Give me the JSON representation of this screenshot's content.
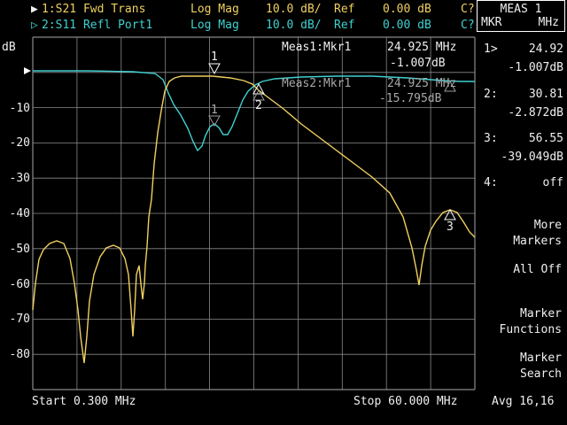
{
  "header": {
    "trace1": {
      "label": "1:S21 Fwd Trans",
      "format": "Log Mag",
      "scale": "10.0 dB/",
      "ref_label": "Ref",
      "ref_value": "0.00 dB",
      "flag": "C?"
    },
    "trace2": {
      "label": "2:S11 Refl Port1",
      "format": "Log Mag",
      "scale": "10.0 dB/",
      "ref_label": "Ref",
      "ref_value": "0.00 dB",
      "flag": "C?"
    }
  },
  "meas_box": {
    "title": "MEAS 1",
    "left": "MKR",
    "right": "MHz"
  },
  "unit_label": "dB",
  "y_ticks": [
    "-10",
    "-20",
    "-30",
    "-40",
    "-50",
    "-60",
    "-70",
    "-80"
  ],
  "meas1": {
    "label": "Meas1:Mkr1",
    "freq": "24.925 MHz",
    "value": "-1.007dB"
  },
  "meas2": {
    "label": "Meas2:Mkr1",
    "freq": "24.925 MHz",
    "value": "-15.795dB"
  },
  "marker_labels": [
    "1",
    "2",
    "3"
  ],
  "markers": [
    {
      "id": "1>",
      "freq": "24.92",
      "value": "-1.007dB"
    },
    {
      "id": "2:",
      "freq": "30.81",
      "value": "-2.872dB"
    },
    {
      "id": "3:",
      "freq": "56.55",
      "value": "-39.049dB"
    },
    {
      "id": "4:",
      "freq": "off"
    }
  ],
  "softkeys": {
    "more_markers": [
      "More",
      "Markers"
    ],
    "all_off": "All Off",
    "marker_functions": [
      "Marker",
      "Functions"
    ],
    "marker_search": [
      "Marker",
      "Search"
    ]
  },
  "footer": {
    "start": "Start 0.300 MHz",
    "stop": "Stop 60.000 MHz",
    "avg": "Avg 16,16"
  },
  "colors": {
    "trace1": "#f0d060",
    "trace2": "#40d0d0",
    "grid": "#8a8a8a",
    "background": "#000000"
  }
}
